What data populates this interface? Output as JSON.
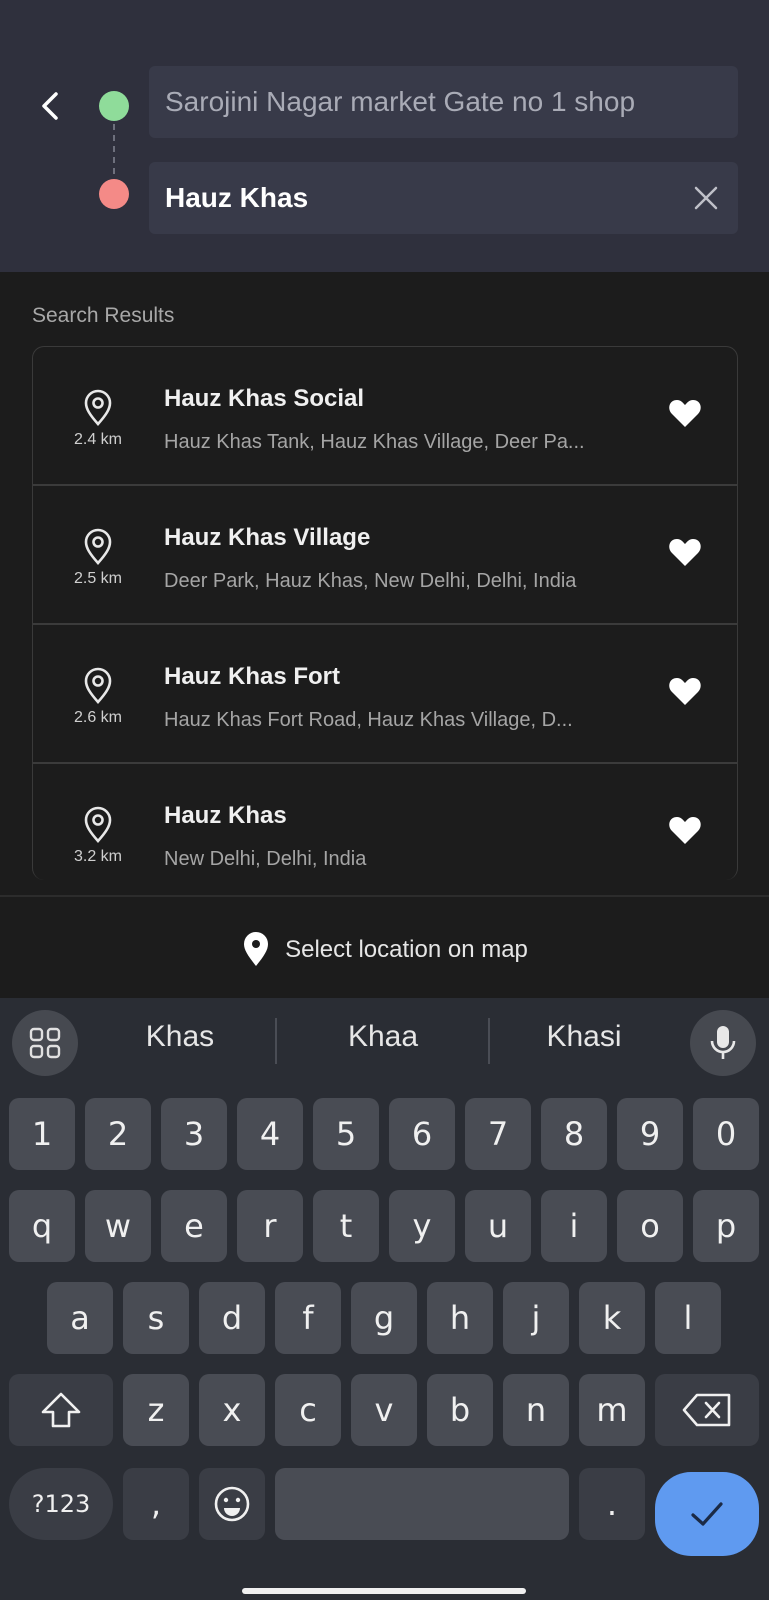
{
  "search": {
    "origin_value": "Sarojini Nagar market Gate no 1 shop",
    "destination_value": "Hauz Khas"
  },
  "results": {
    "label": "Search Results",
    "items": [
      {
        "distance": "2.4 km",
        "title": "Hauz Khas Social",
        "subtitle": "Hauz Khas Tank, Hauz Khas Village, Deer Pa..."
      },
      {
        "distance": "2.5 km",
        "title": "Hauz Khas Village",
        "subtitle": "Deer Park, Hauz Khas, New Delhi, Delhi, India"
      },
      {
        "distance": "2.6 km",
        "title": "Hauz Khas Fort",
        "subtitle": "Hauz Khas Fort Road, Hauz Khas Village, D..."
      },
      {
        "distance": "3.2 km",
        "title": "Hauz Khas",
        "subtitle": "New Delhi, Delhi, India"
      }
    ]
  },
  "map_link": {
    "label": "Select location on map"
  },
  "keyboard": {
    "suggestions": [
      "Khas",
      "Khaa",
      "Khasi"
    ],
    "row_numbers": [
      "1",
      "2",
      "3",
      "4",
      "5",
      "6",
      "7",
      "8",
      "9",
      "0"
    ],
    "row_q": [
      "q",
      "w",
      "e",
      "r",
      "t",
      "y",
      "u",
      "i",
      "o",
      "p"
    ],
    "row_a": [
      "a",
      "s",
      "d",
      "f",
      "g",
      "h",
      "j",
      "k",
      "l"
    ],
    "row_z": [
      "z",
      "x",
      "c",
      "v",
      "b",
      "n",
      "m"
    ],
    "symbols_label": "?123",
    "comma": ",",
    "period": "."
  },
  "colors": {
    "origin_dot": "#8fdc9a",
    "destination_dot": "#f48a87",
    "enter_key": "#5f9af0"
  }
}
